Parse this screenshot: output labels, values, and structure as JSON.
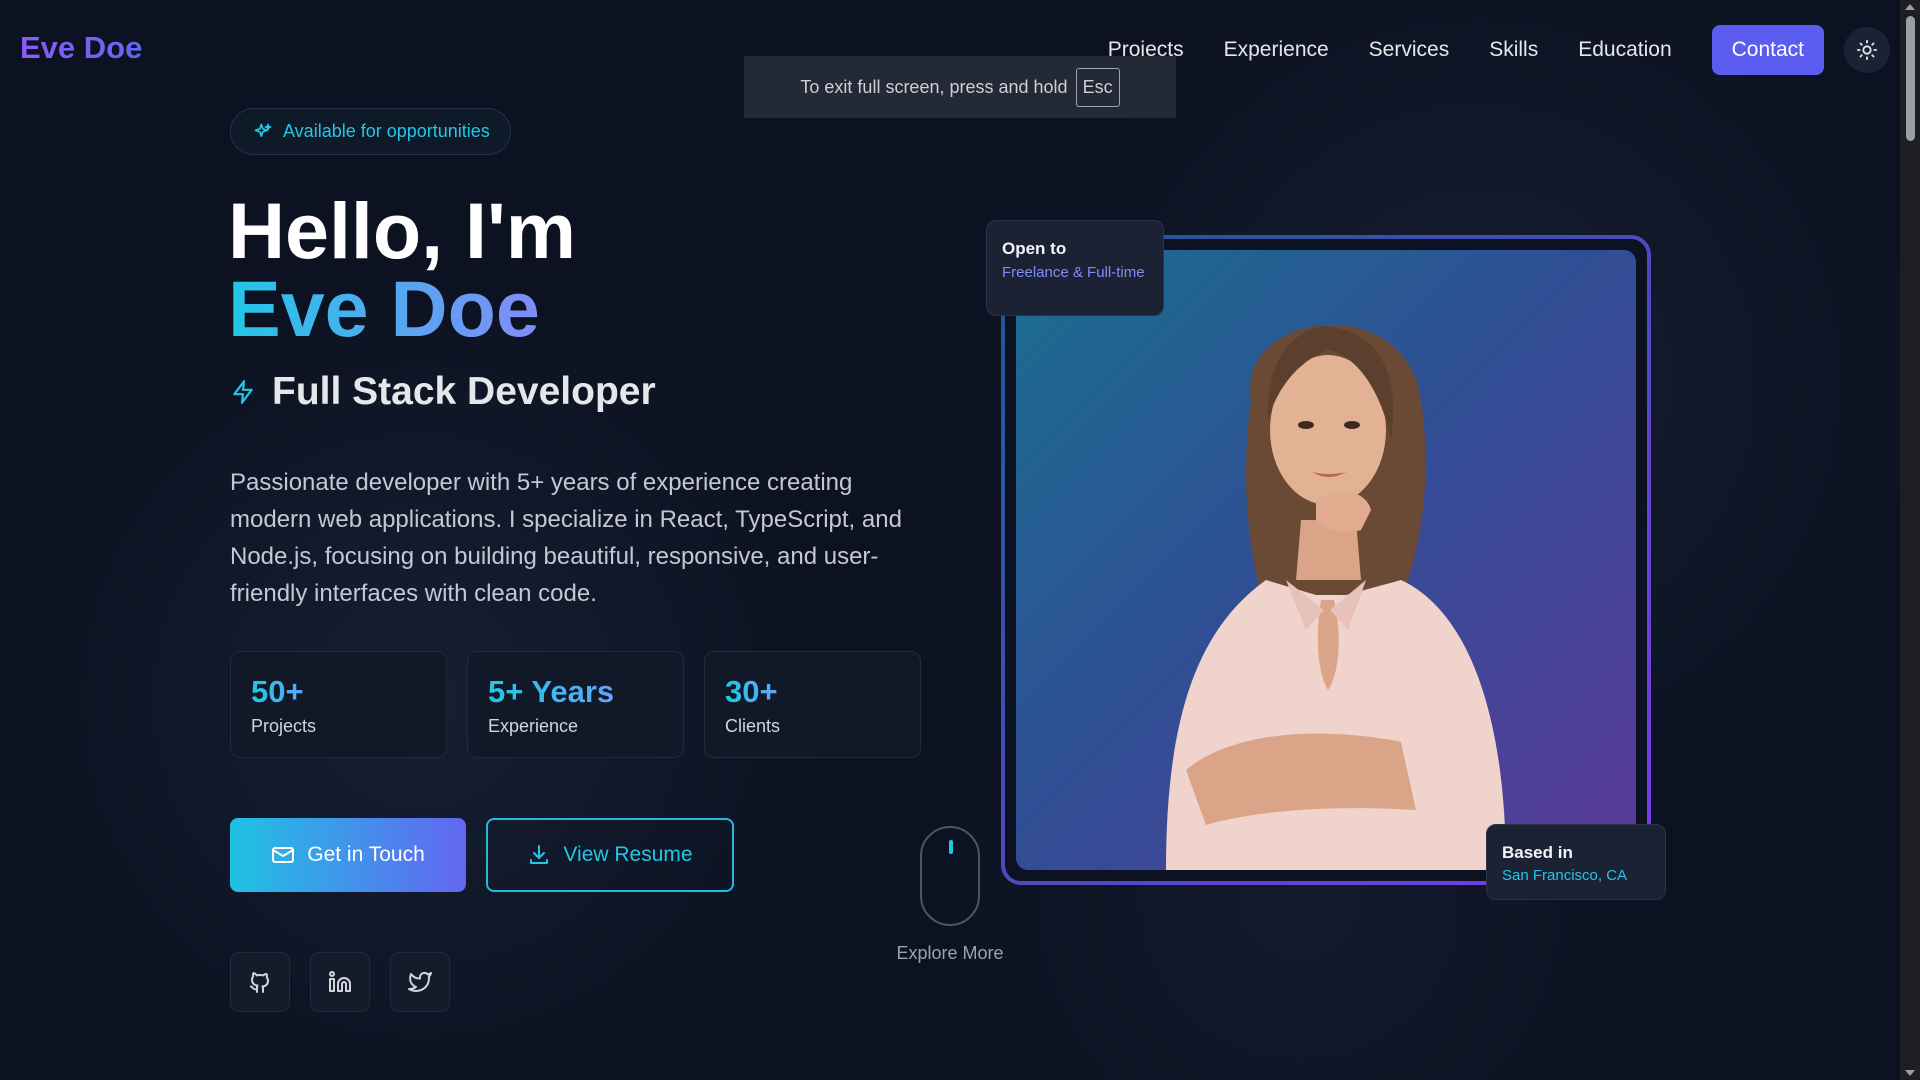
{
  "brand": {
    "logo": "Eve Doe"
  },
  "nav": {
    "links": [
      "Projects",
      "Experience",
      "Services",
      "Skills",
      "Education"
    ],
    "contact": "Contact"
  },
  "fullscreen_toast": {
    "text": "To exit full screen, press and hold",
    "key": "Esc"
  },
  "hero": {
    "badge": "Available for opportunities",
    "greeting": "Hello, I'm",
    "name": "Eve Doe",
    "role": "Full Stack Developer",
    "description": "Passionate developer with 5+ years of experience creating modern web applications. I specialize in React, TypeScript, and Node.js, focusing on building beautiful, responsive, and user-friendly interfaces with clean code."
  },
  "stats": [
    {
      "value": "50+",
      "label": "Projects"
    },
    {
      "value": "5+ Years",
      "label": "Experience"
    },
    {
      "value": "30+",
      "label": "Clients"
    }
  ],
  "buttons": {
    "primary": "Get in Touch",
    "secondary": "View Resume"
  },
  "scroll_hint": "Explore More",
  "cards": {
    "open_title": "Open to",
    "open_sub": "Freelance & Full-time",
    "based_title": "Based in",
    "based_sub": "San Francisco, CA"
  },
  "colors": {
    "accent_cyan": "#22c7e6",
    "accent_indigo": "#5b5cf0",
    "background": "#0c1221"
  }
}
